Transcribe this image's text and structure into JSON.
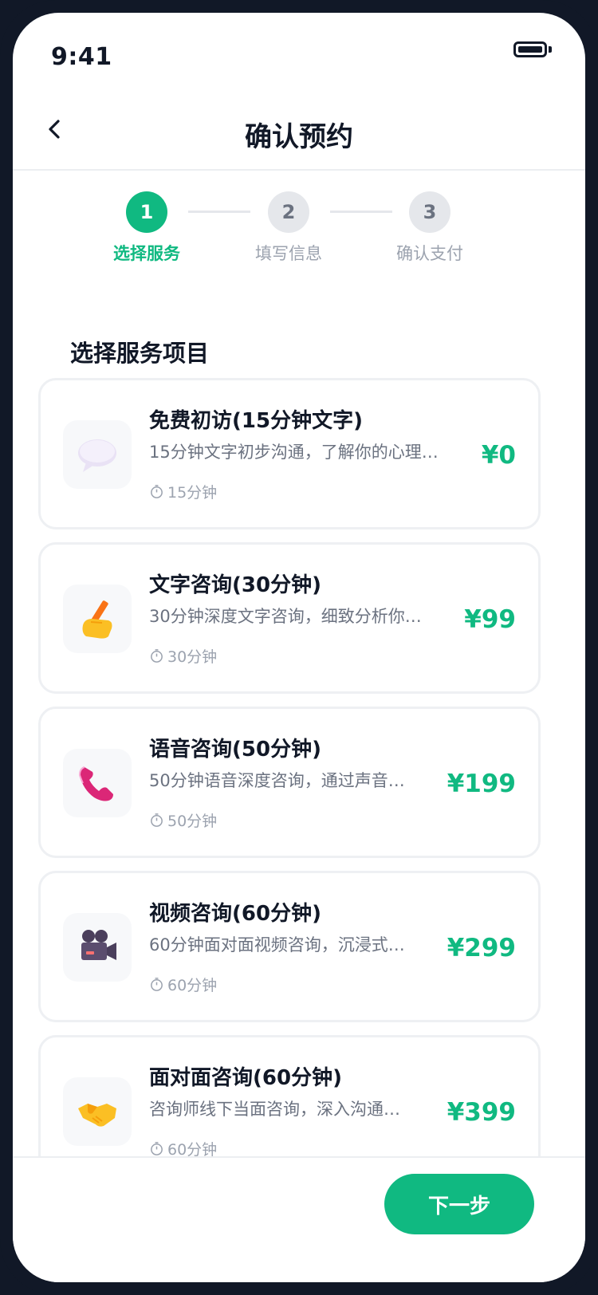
{
  "status_bar": {
    "time": "9:41"
  },
  "nav": {
    "title": "确认预约"
  },
  "stepper": {
    "steps": [
      {
        "number": "1",
        "label": "选择服务"
      },
      {
        "number": "2",
        "label": "填写信息"
      },
      {
        "number": "3",
        "label": "确认支付"
      }
    ],
    "active_step": 1
  },
  "section": {
    "title": "选择服务项目"
  },
  "services": [
    {
      "icon": "speech-bubble-icon",
      "name": "免费初访(15分钟文字)",
      "description": "15分钟文字初步沟通，了解你的心理…",
      "duration": "15分钟",
      "price": "¥0"
    },
    {
      "icon": "writing-hand-icon",
      "name": "文字咨询(30分钟)",
      "description": "30分钟深度文字咨询，细致分析你…",
      "duration": "30分钟",
      "price": "¥99"
    },
    {
      "icon": "telephone-icon",
      "name": "语音咨询(50分钟)",
      "description": "50分钟语音深度咨询，通过声音…",
      "duration": "50分钟",
      "price": "¥199"
    },
    {
      "icon": "video-camera-icon",
      "name": "视频咨询(60分钟)",
      "description": "60分钟面对面视频咨询，沉浸式…",
      "duration": "60分钟",
      "price": "¥299"
    },
    {
      "icon": "handshake-icon",
      "name": "面对面咨询(60分钟)",
      "description": "咨询师线下当面咨询，深入沟通…",
      "duration": "60分钟",
      "price": "¥399"
    }
  ],
  "footer": {
    "next_label": "下一步"
  },
  "colors": {
    "accent": "#10b981",
    "text_primary": "#111827",
    "text_secondary": "#6b7280",
    "text_muted": "#9ca3af"
  }
}
